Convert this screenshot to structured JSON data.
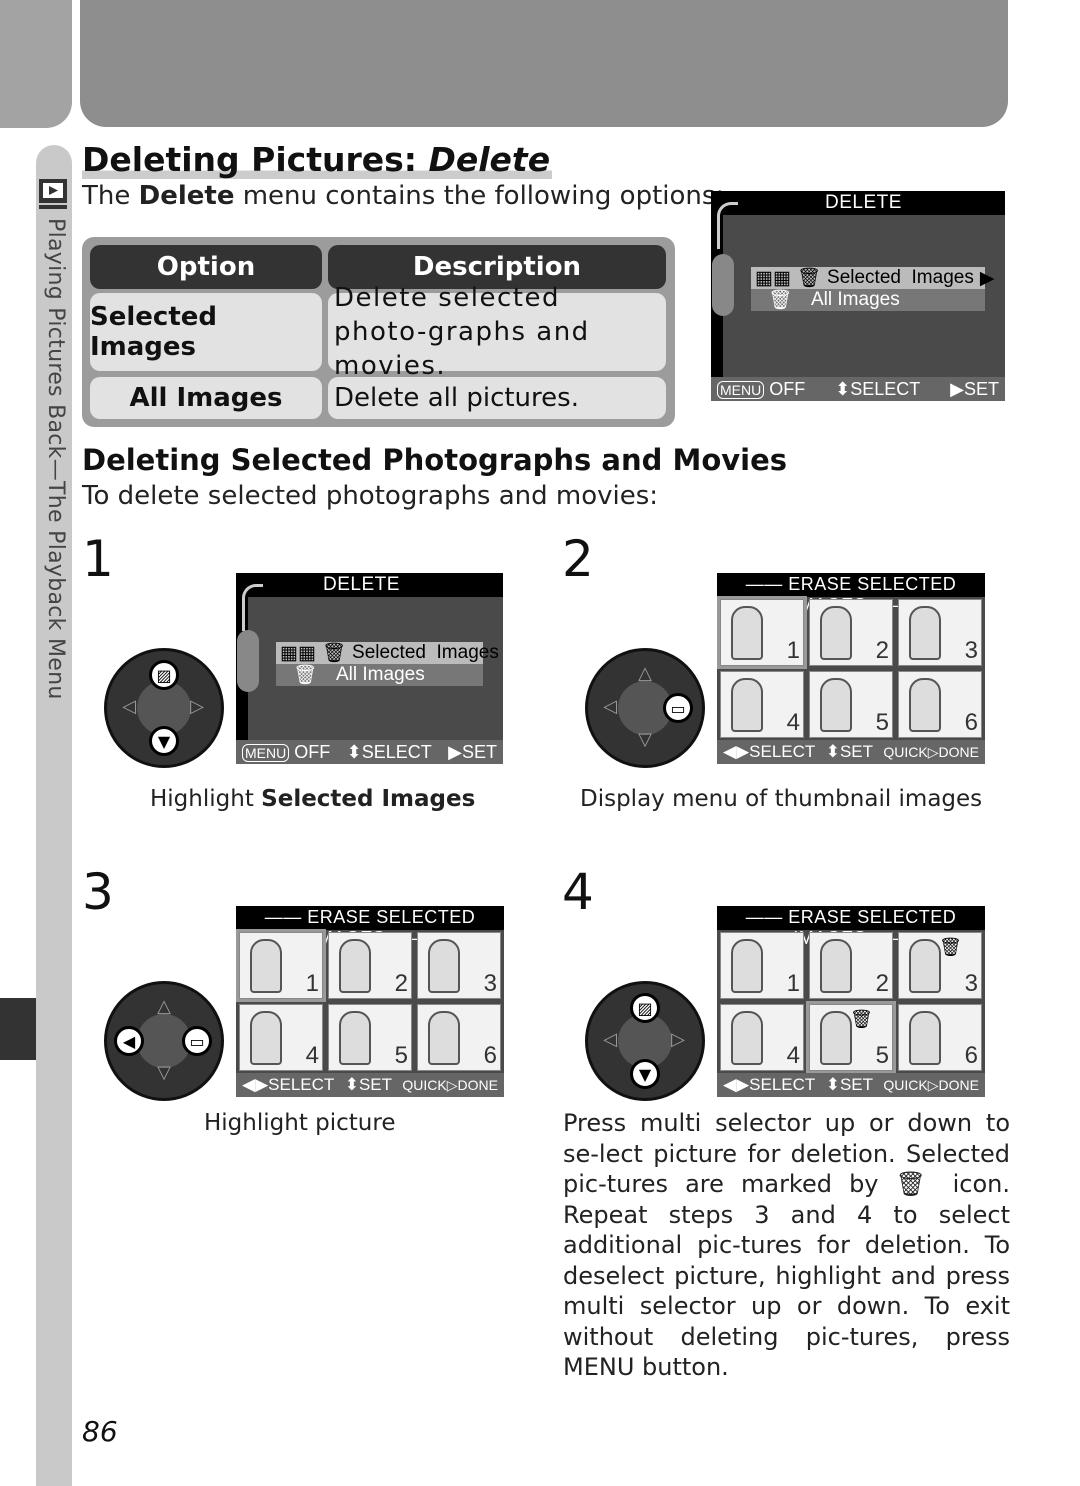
{
  "sidebar": {
    "section": "Playing Pictures Back—The Playback Menu",
    "icon": "playback-icon"
  },
  "title": {
    "main": "Deleting Pictures: ",
    "italic": "Delete"
  },
  "intro": {
    "pre": "The ",
    "bold": "Delete",
    "post": " menu contains the following options:"
  },
  "table": {
    "headers": [
      "Option",
      "Description"
    ],
    "rows": [
      {
        "option": "Selected Images",
        "description": "Delete selected photo-graphs and movies."
      },
      {
        "option": "All Images",
        "description": "Delete all pictures."
      }
    ]
  },
  "lcd_menu": {
    "title": "DELETE",
    "items": [
      "Selected  Images",
      "All Images"
    ],
    "footer": {
      "menu": "MENU",
      "off": "OFF",
      "select": "SELECT",
      "set": "SET"
    }
  },
  "lcd_erase": {
    "title": "ERASE SELECTED IMAGES",
    "thumbs": [
      "1",
      "2",
      "3",
      "4",
      "5",
      "6"
    ],
    "footer": {
      "select": "SELECT",
      "set": "SET",
      "quick": "QUICK",
      "done": "DONE"
    }
  },
  "section": {
    "heading": "Deleting Selected Photographs and Movies",
    "sub": "To delete selected photographs and movies:"
  },
  "steps": [
    {
      "num": "1",
      "caption_pre": "Highlight ",
      "caption_bold": "Selected Images"
    },
    {
      "num": "2",
      "caption": "Display menu of thumbnail images"
    },
    {
      "num": "3",
      "caption": "Highlight picture"
    },
    {
      "num": "4",
      "caption": "Press multi selector up or down to se-lect picture for deletion.  Selected pic-tures are marked by 🗑 icon.  Repeat steps 3 and 4 to select additional pic-tures for deletion.  To deselect picture, highlight and press multi selector up or down.  To exit without deleting pic-tures, press MENU button."
    }
  ],
  "page_number": "86"
}
